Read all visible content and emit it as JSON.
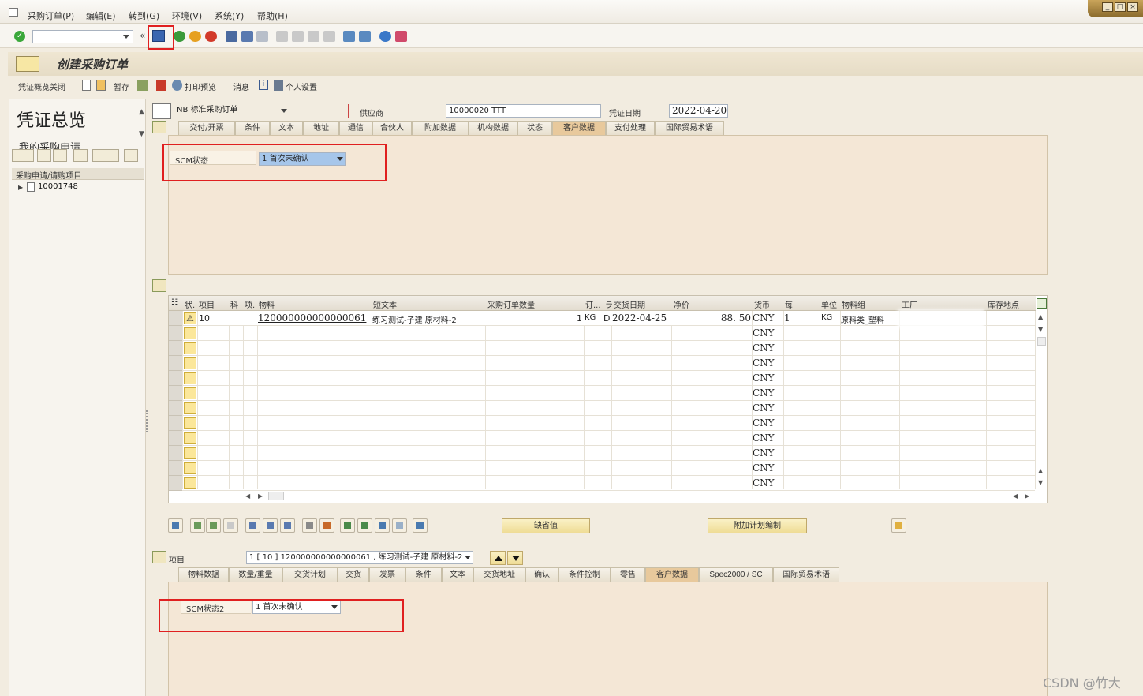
{
  "menu": [
    "采购订单(P)",
    "编辑(E)",
    "转到(G)",
    "环境(V)",
    "系统(Y)",
    "帮助(H)"
  ],
  "toolbar": {
    "command_value": ""
  },
  "title": "创建采购订单",
  "app_toolbar": {
    "overview_close": "凭证概览关闭",
    "hold": "暂存",
    "print_preview": "打印预览",
    "messages": "消息",
    "personal_settings": "个人设置"
  },
  "left_pane": {
    "title": "凭证总览",
    "subtitle": "我的采购申请",
    "list_header": "采购申请/请购项目",
    "tree_item": "10001748"
  },
  "header": {
    "doc_type": "NB 标准采购订单",
    "vendor_label": "供应商",
    "vendor_value": "10000020 TTT",
    "doc_date_label": "凭证日期",
    "doc_date_value": "2022-04-20",
    "tabs": [
      "交付/开票",
      "条件",
      "文本",
      "地址",
      "通信",
      "合伙人",
      "附加数据",
      "机构数据",
      "状态",
      "客户数据",
      "支付处理",
      "国际贸易术语"
    ],
    "active_tab": "客户数据",
    "scm_label": "SCM状态",
    "scm_value": "1 首次未确认"
  },
  "items_table": {
    "columns": [
      "状.",
      "项目",
      "科",
      "项.",
      "物料",
      "短文本",
      "采购订单数量",
      "订...",
      "ラ",
      "交货日期",
      "净价",
      "货币",
      "每",
      "单位",
      "物料组",
      "工厂",
      "库存地点"
    ],
    "rows": [
      {
        "item": "10",
        "material": "120000000000000061",
        "short_text": "练习测试-子建 原材料-2",
        "qty": "1",
        "uom": "KG",
        "cat": "D",
        "delivery": "2022-04-25",
        "price": "88. 50",
        "currency": "CNY",
        "per": "1",
        "unit": "KG",
        "matgroup": "原料类_塑料"
      },
      {
        "currency": "CNY"
      },
      {
        "currency": "CNY"
      },
      {
        "currency": "CNY"
      },
      {
        "currency": "CNY"
      },
      {
        "currency": "CNY"
      },
      {
        "currency": "CNY"
      },
      {
        "currency": "CNY"
      },
      {
        "currency": "CNY"
      },
      {
        "currency": "CNY"
      },
      {
        "currency": "CNY"
      },
      {
        "currency": "CNY"
      }
    ]
  },
  "buttons": {
    "default_values": "缺省值",
    "add_planning": "附加计划编制"
  },
  "item_detail": {
    "label": "项目",
    "selector": "1 [ 10 ] 120000000000000061 , 练习测试-子建 原材料-2",
    "tabs": [
      "物料数据",
      "数量/重量",
      "交货计划",
      "交货",
      "发票",
      "条件",
      "文本",
      "交货地址",
      "确认",
      "条件控制",
      "零售",
      "客户数据",
      "Spec2000 / SC",
      "国际贸易术语"
    ],
    "active_tab": "客户数据",
    "scm2_label": "SCM状态2",
    "scm2_value": "1 首次未确认"
  },
  "watermark": "CSDN @竹大"
}
